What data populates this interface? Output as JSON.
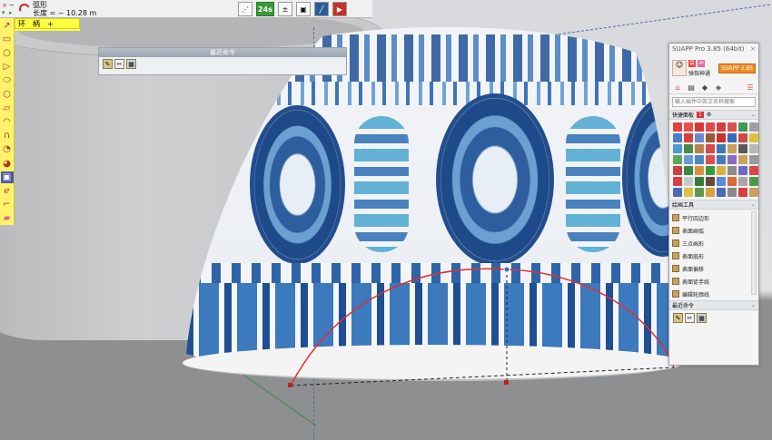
{
  "status_bar": {
    "tool_name": "弧形",
    "length_label": "长度 = ~ 10.28 m",
    "measure_tool_label": "环",
    "measure_value": "柄",
    "plus": "+"
  },
  "top_toolbar": {
    "segments_label": "24s",
    "icons": [
      "dashed-line-icon",
      "segments-icon",
      "plus-minus-icon",
      "box-icon",
      "line-tool-icon",
      "exit-icon"
    ]
  },
  "left_toolbar": {
    "icons": [
      "select-arrow-icon",
      "rectangle-icon",
      "circle-icon",
      "triangle-icon",
      "ellipse-icon",
      "polygon-icon",
      "parallelogram-icon",
      "arc-icon",
      "curve-icon",
      "pie-icon",
      "cut-icon",
      "offset-icon",
      "spiral-icon",
      "line-point-icon",
      "eraser-icon"
    ]
  },
  "recent_panel": {
    "title": "最近命令"
  },
  "suapp": {
    "title": "SUAPP Pro 3.85 (64bit)",
    "close": "×",
    "username": "弹指神通",
    "pro_badge": "SUAPP 3.85",
    "search_placeholder": "输入插件中英文名称搜索",
    "quick_panel_label": "快捷面板",
    "quick_panel_count": "1",
    "drawing_tools_label": "绘画工具",
    "drawing_tools": [
      "平行四边形",
      "表面画弧",
      "三点画形",
      "表面扇形",
      "表面偏移",
      "表面徒手线",
      "编辑轮廓线"
    ],
    "recent_label": "最近命令"
  },
  "colors": {
    "arc_red": "#e03030",
    "viewport_bg": "#dcdee1",
    "ground": "#8d8f91",
    "toolbar_yellow": "#fff36a"
  }
}
